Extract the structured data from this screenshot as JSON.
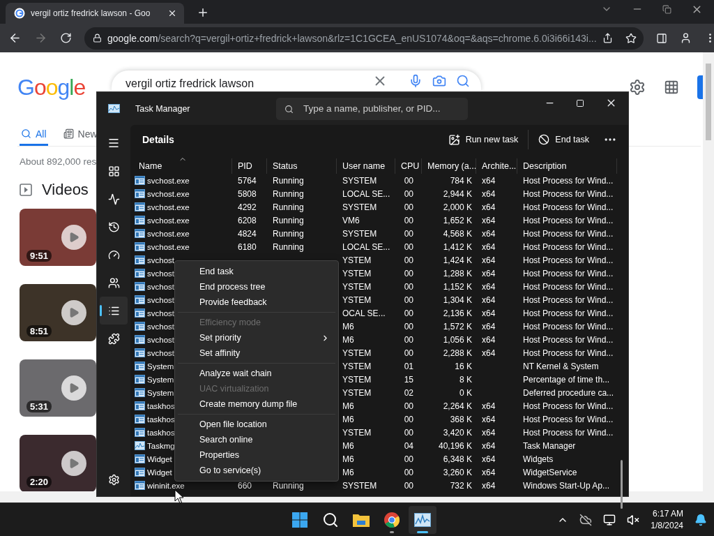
{
  "browser": {
    "tab": {
      "title": "vergil ortiz fredrick lawson - Goo"
    },
    "address": {
      "host": "google.com",
      "path": "/search?q=vergil+ortiz+fredrick+lawson&rlz=1C1GCEA_enUS1074&oq=&aqs=chrome.6.0i3i66i143i..."
    }
  },
  "google": {
    "logo": "Google",
    "search": {
      "value": "vergil ortiz fredrick lawson"
    },
    "tabs": [
      {
        "label": "All",
        "selected": true
      },
      {
        "label": "New",
        "selected": false
      }
    ],
    "result_count": "About 892,000 res",
    "section_title": "Videos",
    "videos": [
      {
        "duration": "9:51"
      },
      {
        "duration": "8:51"
      },
      {
        "duration": "5:31"
      },
      {
        "duration": "2:20"
      }
    ]
  },
  "task_manager": {
    "title": "Task Manager",
    "search": {
      "placeholder": "Type a name, publisher, or PID..."
    },
    "sidebar": {
      "items": [
        {
          "selected": false
        },
        {
          "selected": false
        },
        {
          "selected": false
        },
        {
          "selected": false
        },
        {
          "selected": false
        },
        {
          "selected": true
        },
        {
          "selected": false
        }
      ]
    },
    "page_title": "Details",
    "actions": [
      {
        "label": "Run new task"
      },
      {
        "label": "End task"
      }
    ],
    "table": {
      "columns": [
        {
          "label": "Name",
          "sorted": true
        },
        {
          "label": "PID",
          "sorted": false
        },
        {
          "label": "Status",
          "sorted": false
        },
        {
          "label": "User name",
          "sorted": false
        },
        {
          "label": "CPU",
          "sorted": false
        },
        {
          "label": "Memory (a...",
          "sorted": false
        },
        {
          "label": "Archite...",
          "sorted": false
        },
        {
          "label": "Description",
          "sorted": false
        }
      ],
      "rows": [
        {
          "kind": "process",
          "name": "svchost.exe",
          "pid": "5764",
          "status": "Running",
          "user": "SYSTEM",
          "cpu": "00",
          "memory": "784 K",
          "arch": "x64",
          "description": "Host Process for Wind..."
        },
        {
          "kind": "process",
          "name": "svchost.exe",
          "pid": "5808",
          "status": "Running",
          "user": "LOCAL SE...",
          "cpu": "00",
          "memory": "2,944 K",
          "arch": "x64",
          "description": "Host Process for Wind..."
        },
        {
          "kind": "process",
          "name": "svchost.exe",
          "pid": "4292",
          "status": "Running",
          "user": "SYSTEM",
          "cpu": "00",
          "memory": "2,000 K",
          "arch": "x64",
          "description": "Host Process for Wind..."
        },
        {
          "kind": "process",
          "name": "svchost.exe",
          "pid": "6208",
          "status": "Running",
          "user": "VM6",
          "cpu": "00",
          "memory": "1,652 K",
          "arch": "x64",
          "description": "Host Process for Wind..."
        },
        {
          "kind": "process",
          "name": "svchost.exe",
          "pid": "4824",
          "status": "Running",
          "user": "SYSTEM",
          "cpu": "00",
          "memory": "4,568 K",
          "arch": "x64",
          "description": "Host Process for Wind..."
        },
        {
          "kind": "process",
          "name": "svchost.exe",
          "pid": "6180",
          "status": "Running",
          "user": "LOCAL SE...",
          "cpu": "00",
          "memory": "1,412 K",
          "arch": "x64",
          "description": "Host Process for Wind..."
        },
        {
          "kind": "process",
          "name": "svchost",
          "user": "YSTEM",
          "cpu": "00",
          "memory": "1,424 K",
          "arch": "x64",
          "description": "Host Process for Wind..."
        },
        {
          "kind": "process",
          "name": "svchost",
          "user": "YSTEM",
          "cpu": "00",
          "memory": "1,288 K",
          "arch": "x64",
          "description": "Host Process for Wind..."
        },
        {
          "kind": "process",
          "name": "svchost",
          "user": "YSTEM",
          "cpu": "00",
          "memory": "1,152 K",
          "arch": "x64",
          "description": "Host Process for Wind..."
        },
        {
          "kind": "process",
          "name": "svchost",
          "user": "YSTEM",
          "cpu": "00",
          "memory": "1,304 K",
          "arch": "x64",
          "description": "Host Process for Wind..."
        },
        {
          "kind": "process",
          "name": "svchost",
          "user": "OCAL SE...",
          "cpu": "00",
          "memory": "2,136 K",
          "arch": "x64",
          "description": "Host Process for Wind..."
        },
        {
          "kind": "process",
          "name": "svchost",
          "user": "M6",
          "cpu": "00",
          "memory": "1,572 K",
          "arch": "x64",
          "description": "Host Process for Wind..."
        },
        {
          "kind": "process",
          "name": "svchost",
          "user": "M6",
          "cpu": "00",
          "memory": "1,056 K",
          "arch": "x64",
          "description": "Host Process for Wind..."
        },
        {
          "kind": "process",
          "name": "svchost",
          "user": "YSTEM",
          "cpu": "00",
          "memory": "2,288 K",
          "arch": "x64",
          "description": "Host Process for Wind..."
        },
        {
          "kind": "process",
          "name": "System",
          "user": "YSTEM",
          "cpu": "01",
          "memory": "16 K",
          "description": "NT Kernel & System"
        },
        {
          "kind": "process",
          "name": "System",
          "user": "YSTEM",
          "cpu": "15",
          "memory": "8 K",
          "description": "Percentage of time th..."
        },
        {
          "kind": "process",
          "name": "System",
          "user": "YSTEM",
          "cpu": "02",
          "memory": "0 K",
          "description": "Deferred procedure ca..."
        },
        {
          "kind": "process",
          "name": "taskhos",
          "user": "M6",
          "cpu": "00",
          "memory": "2,264 K",
          "arch": "x64",
          "description": "Host Process for Wind..."
        },
        {
          "kind": "process",
          "name": "taskhos",
          "user": "M6",
          "cpu": "00",
          "memory": "368 K",
          "arch": "x64",
          "description": "Host Process for Wind..."
        },
        {
          "kind": "process",
          "name": "taskhos",
          "user": "YSTEM",
          "cpu": "00",
          "memory": "3,420 K",
          "arch": "x64",
          "description": "Host Process for Wind..."
        },
        {
          "kind": "monitor",
          "name": "Taskmg",
          "user": "M6",
          "cpu": "04",
          "memory": "40,196 K",
          "arch": "x64",
          "description": "Task Manager"
        },
        {
          "kind": "process",
          "name": "Widget",
          "user": "M6",
          "cpu": "00",
          "memory": "6,348 K",
          "arch": "x64",
          "description": "Widgets"
        },
        {
          "kind": "process",
          "name": "Widget",
          "user": "M6",
          "cpu": "00",
          "memory": "3,260 K",
          "arch": "x64",
          "description": "WidgetService"
        },
        {
          "kind": "process",
          "name": "wininit.exe",
          "pid": "660",
          "status": "Running",
          "user": "SYSTEM",
          "cpu": "00",
          "memory": "732 K",
          "arch": "x64",
          "description": "Windows Start-Up Ap..."
        }
      ]
    }
  },
  "context_menu": {
    "groups": [
      [
        {
          "label": "End task",
          "disabled": false,
          "submenu": false
        },
        {
          "label": "End process tree",
          "disabled": false,
          "submenu": false
        },
        {
          "label": "Provide feedback",
          "disabled": false,
          "submenu": false
        }
      ],
      [
        {
          "label": "Efficiency mode",
          "disabled": true,
          "submenu": false
        },
        {
          "label": "Set priority",
          "disabled": false,
          "submenu": true
        },
        {
          "label": "Set affinity",
          "disabled": false,
          "submenu": false
        }
      ],
      [
        {
          "label": "Analyze wait chain",
          "disabled": false,
          "submenu": false
        },
        {
          "label": "UAC virtualization",
          "disabled": true,
          "submenu": false
        },
        {
          "label": "Create memory dump file",
          "disabled": false,
          "submenu": false
        }
      ],
      [
        {
          "label": "Open file location",
          "disabled": false,
          "submenu": false
        },
        {
          "label": "Search online",
          "disabled": false,
          "submenu": false
        },
        {
          "label": "Properties",
          "disabled": false,
          "submenu": false
        },
        {
          "label": "Go to service(s)",
          "disabled": false,
          "submenu": false
        }
      ]
    ]
  },
  "taskbar": {
    "apps": [
      {
        "running": false,
        "active": false
      },
      {
        "running": false,
        "active": false
      },
      {
        "running": false,
        "active": false
      },
      {
        "running": true,
        "active": false
      },
      {
        "running": true,
        "active": true
      }
    ],
    "time": "6:17 AM",
    "date": "1/8/2024"
  }
}
